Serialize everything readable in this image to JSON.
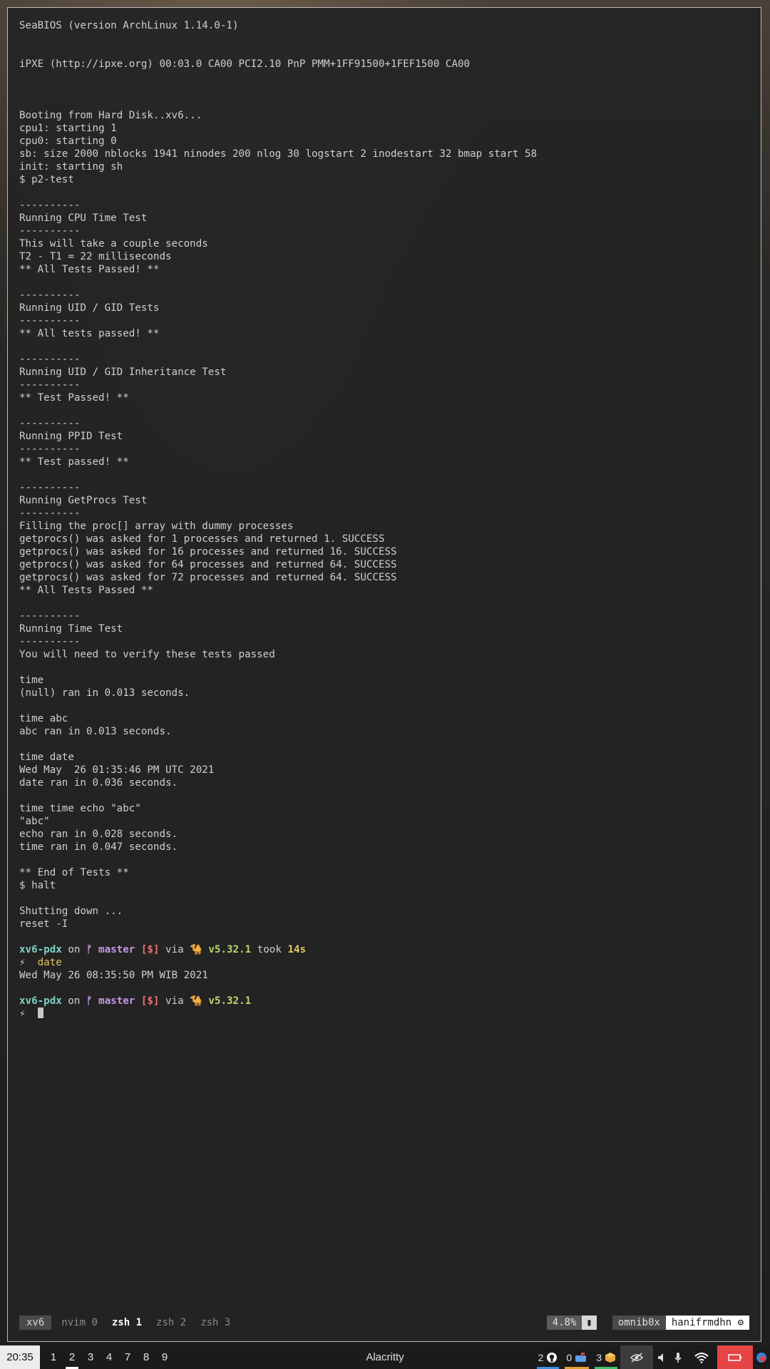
{
  "terminal": {
    "lines": [
      "SeaBIOS (version ArchLinux 1.14.0-1)",
      "",
      "",
      "iPXE (http://ipxe.org) 00:03.0 CA00 PCI2.10 PnP PMM+1FF91500+1FEF1500 CA00",
      "",
      "",
      "",
      "Booting from Hard Disk..xv6...",
      "cpu1: starting 1",
      "cpu0: starting 0",
      "sb: size 2000 nblocks 1941 ninodes 200 nlog 30 logstart 2 inodestart 32 bmap start 58",
      "init: starting sh",
      "$ p2-test",
      "",
      "----------",
      "Running CPU Time Test",
      "----------",
      "This will take a couple seconds",
      "T2 - T1 = 22 milliseconds",
      "** All Tests Passed! **",
      "",
      "----------",
      "Running UID / GID Tests",
      "----------",
      "** All tests passed! **",
      "",
      "----------",
      "Running UID / GID Inheritance Test",
      "----------",
      "** Test Passed! **",
      "",
      "----------",
      "Running PPID Test",
      "----------",
      "** Test passed! **",
      "",
      "----------",
      "Running GetProcs Test",
      "----------",
      "Filling the proc[] array with dummy processes",
      "getprocs() was asked for 1 processes and returned 1. SUCCESS",
      "getprocs() was asked for 16 processes and returned 16. SUCCESS",
      "getprocs() was asked for 64 processes and returned 64. SUCCESS",
      "getprocs() was asked for 72 processes and returned 64. SUCCESS",
      "** All Tests Passed **",
      "",
      "----------",
      "Running Time Test",
      "----------",
      "You will need to verify these tests passed",
      "",
      "time",
      "(null) ran in 0.013 seconds.",
      "",
      "time abc",
      "abc ran in 0.013 seconds.",
      "",
      "time date",
      "Wed May  26 01:35:46 PM UTC 2021",
      "date ran in 0.036 seconds.",
      "",
      "time time echo \"abc\"",
      "\"abc\"",
      "echo ran in 0.028 seconds.",
      "time ran in 0.047 seconds.",
      "",
      "** End of Tests **",
      "$ halt",
      "",
      "Shutting down ...",
      "reset -I",
      ""
    ],
    "prompt1": {
      "dir": "xv6-pdx",
      "on": " on ",
      "branch_icon": "",
      "branch": "master",
      "status": "[$]",
      "via": " via ",
      "camel": "🐪",
      "version": "v5.32.1",
      "took": " took ",
      "duration": "14s",
      "symbol": "⚡",
      "command": "date"
    },
    "date_output": "Wed May 26 08:35:50 PM WIB 2021",
    "prompt2": {
      "dir": "xv6-pdx",
      "on": " on ",
      "branch_icon": "",
      "branch": "master",
      "status": "[$]",
      "via": " via ",
      "camel": "🐪",
      "version": "v5.32.1",
      "symbol": "⚡"
    }
  },
  "tmux": {
    "session": "xv6",
    "windows": [
      {
        "label": "nvim 0",
        "active": false
      },
      {
        "label": "zsh 1",
        "active": true
      },
      {
        "label": "zsh 2",
        "active": false
      },
      {
        "label": "zsh 3",
        "active": false
      }
    ],
    "cpu": "4.8%",
    "host": "omnib0x",
    "user": "hanifrmdhn",
    "user_icon": "⚙"
  },
  "sysbar": {
    "clock": "20:35",
    "workspaces": [
      "1",
      "2",
      "3",
      "4",
      "7",
      "8",
      "9"
    ],
    "active_workspace": "2",
    "window_title": "Alacritty",
    "github_count": "2",
    "mail_count": "0",
    "package_count": "3",
    "colors": {
      "github_underline": "#3b8fe0",
      "mail_underline": "#e0a030",
      "package_underline": "#3fbf6f",
      "power_bg": "#e54545"
    }
  }
}
